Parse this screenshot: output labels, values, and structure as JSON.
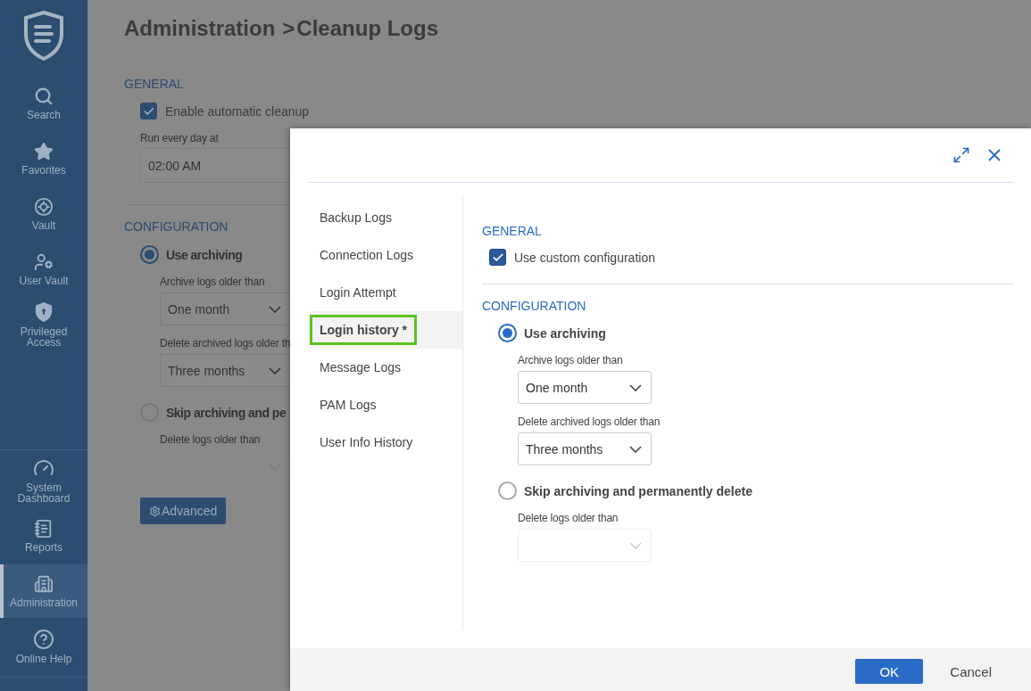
{
  "sidebar": {
    "top_items": [
      {
        "label": "Search",
        "selected": false
      },
      {
        "label": "Favorites",
        "selected": false
      },
      {
        "label": "Vault",
        "selected": false
      },
      {
        "label": "User Vault",
        "selected": false
      },
      {
        "label": "Privileged Access",
        "selected": false
      }
    ],
    "bottom_items": [
      {
        "label": "System Dashboard",
        "selected": false
      },
      {
        "label": "Reports",
        "selected": false
      },
      {
        "label": "Administration",
        "selected": true
      },
      {
        "label": "Online Help",
        "selected": false
      }
    ]
  },
  "page": {
    "breadcrumb": [
      "Administration",
      "Cleanup Logs"
    ],
    "breadcrumb_separator": ">",
    "general": {
      "heading": "GENERAL",
      "enable_cleanup": {
        "label": "Enable automatic cleanup",
        "checked": true
      },
      "run_label": "Run every day at",
      "run_time": "02:00 AM"
    },
    "configuration": {
      "heading": "CONFIGURATION",
      "options": [
        {
          "label": "Use archiving",
          "selected": true,
          "fields": [
            {
              "label": "Archive logs older than",
              "value": "One month",
              "disabled": false
            },
            {
              "label": "Delete archived logs older th",
              "value": "Three months",
              "disabled": false
            }
          ]
        },
        {
          "label": "Skip archiving and pe",
          "selected": false,
          "fields": [
            {
              "label": "Delete logs older than",
              "disabled": true
            }
          ]
        }
      ]
    },
    "advanced_button": "Advanced"
  },
  "dialog": {
    "nav": [
      {
        "label": "Backup Logs",
        "selected": false
      },
      {
        "label": "Connection Logs",
        "selected": false
      },
      {
        "label": "Login Attempt",
        "selected": false
      },
      {
        "label": "Login history *",
        "selected": true
      },
      {
        "label": "Message Logs",
        "selected": false
      },
      {
        "label": "PAM Logs",
        "selected": false
      },
      {
        "label": "User Info History",
        "selected": false
      }
    ],
    "general": {
      "heading": "GENERAL",
      "custom": {
        "label": "Use custom configuration",
        "checked": true
      }
    },
    "configuration": {
      "heading": "CONFIGURATION",
      "options": [
        {
          "label": "Use archiving",
          "selected": true,
          "fields": [
            {
              "label": "Archive logs older than",
              "value": "One month",
              "disabled": false
            },
            {
              "label": "Delete archived logs older than",
              "value": "Three months",
              "disabled": false
            }
          ]
        },
        {
          "label": "Skip archiving and permanently delete",
          "selected": false,
          "fields": [
            {
              "label": "Delete logs older than",
              "disabled": true
            }
          ]
        }
      ]
    },
    "buttons": {
      "ok": "OK",
      "cancel": "Cancel"
    }
  }
}
